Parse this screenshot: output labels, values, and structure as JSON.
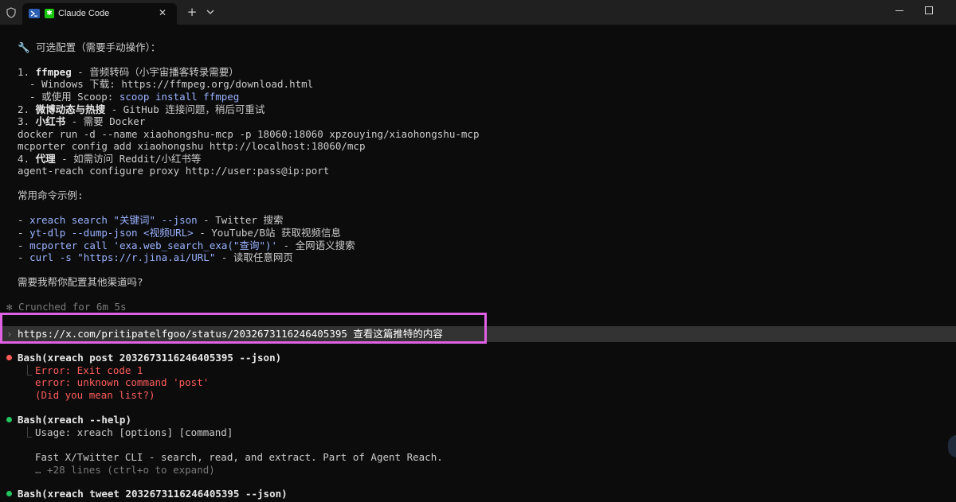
{
  "tabbar": {
    "tab_title": "Claude Code",
    "close_glyph": "✕",
    "new_tab_glyph": "+",
    "claude_glyph": "✱"
  },
  "terminal": {
    "optional_heading": "🔧 可选配置（需要手动操作）：",
    "item1_num": "1. ",
    "item1_name": "ffmpeg",
    "item1_rest": " - 音频转码（小宇宙播客转录需要）",
    "item1_sub1": "  - Windows 下载: https://ffmpeg.org/download.html",
    "item1_sub2_a": "  - 或使用 Scoop: ",
    "item1_sub2_b": "scoop install ffmpeg",
    "item2_num": "2. ",
    "item2_name": "微博动态与热搜",
    "item2_rest": " - GitHub 连接问题，稍后可重试",
    "item3_num": "3. ",
    "item3_name": "小红书",
    "item3_rest": " - 需要 Docker",
    "item3_cmd1": "docker run -d --name xiaohongshu-mcp -p 18060:18060 xpzouying/xiaohongshu-mcp",
    "item3_cmd2": "mcporter config add xiaohongshu http://localhost:18060/mcp",
    "item4_num": "4. ",
    "item4_name": "代理",
    "item4_rest": " - 如需访问 Reddit/小红书等",
    "item4_cmd": "agent-reach configure proxy http://user:pass@ip:port",
    "examples_heading": "常用命令示例:",
    "ex1_dash": "- ",
    "ex1_cmd": "xreach search \"关键词\" --json",
    "ex1_desc": " - Twitter 搜索",
    "ex2_dash": "- ",
    "ex2_cmd": "yt-dlp --dump-json <视频URL>",
    "ex2_desc": " - YouTube/B站 获取视频信息",
    "ex3_dash": "- ",
    "ex3_cmd": "mcporter call 'exa.web_search_exa(\"查询\")'",
    "ex3_desc": " - 全网语义搜索",
    "ex4_dash": "- ",
    "ex4_cmd": "curl -s \"https://r.jina.ai/URL\"",
    "ex4_desc": " - 读取任意网页",
    "question": "需要我帮你配置其他渠道吗?",
    "crunched": "✻ Crunched for 6m 5s",
    "prompt_marker": "›",
    "prompt_text": "https://x.com/pritipatelfgoo/status/2032673116246405395 查看这篇推特的内容",
    "bash1_title": "Bash(xreach post 2032673116246405395 --json)",
    "bash1_branch": "⎿",
    "bash1_err1": "Error: Exit code 1",
    "bash1_err2": "error: unknown command 'post'",
    "bash1_err3": "(Did you mean list?)",
    "bash2_title": "Bash(xreach --help)",
    "bash2_branch": "⎿",
    "bash2_out1": "Usage: xreach [options] [command]",
    "bash2_out2": "Fast X/Twitter CLI - search, read, and extract. Part of Agent Reach.",
    "bash2_more": "… +28 lines (ctrl+o to expand)",
    "bash3_title": "Bash(xreach tweet 2032673116246405395 --json)"
  },
  "colors": {
    "background": "#0c0c0c",
    "text": "#cccccc",
    "command_blue": "#9ab2ff",
    "error_red": "#ff5c5c",
    "success_green": "#22c55e",
    "highlight_magenta": "#e060e6"
  },
  "icons": {
    "shield": "shield-icon",
    "powershell": "powershell-icon",
    "claude": "claude-icon",
    "close": "close-icon",
    "new_tab": "plus-icon",
    "dropdown": "chevron-down-icon",
    "minimize": "minimize-icon",
    "maximize": "maximize-icon"
  }
}
